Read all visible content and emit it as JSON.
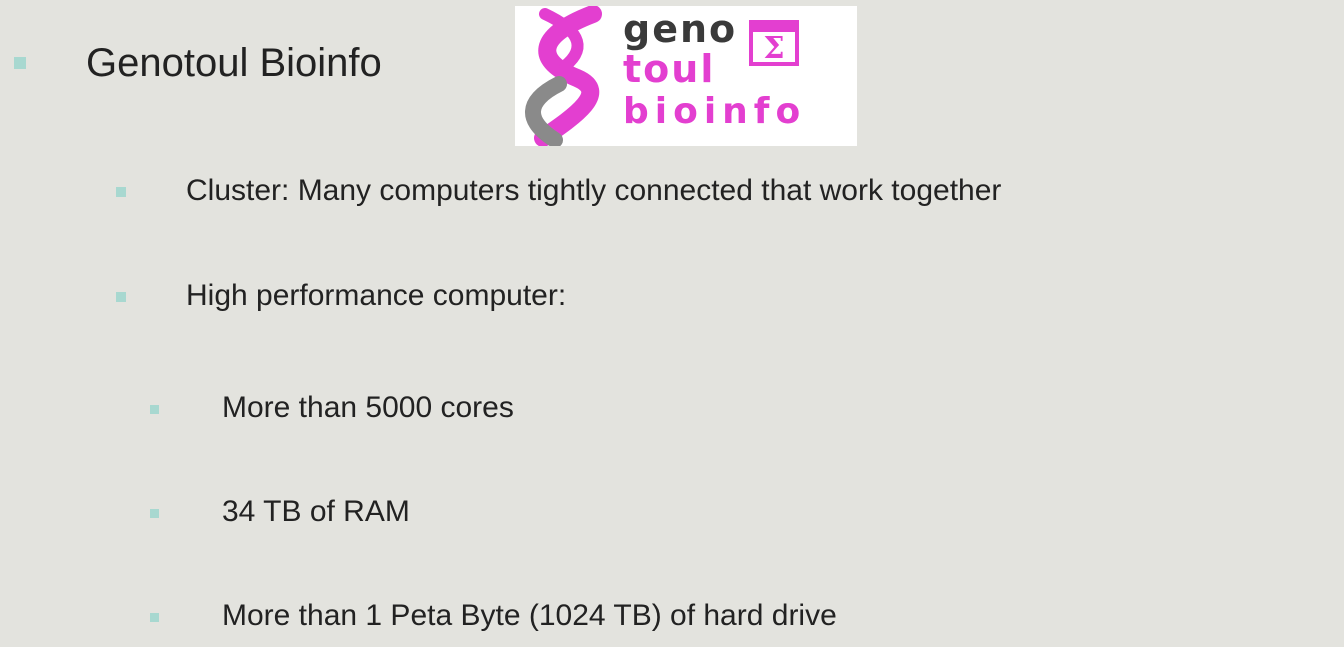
{
  "slide": {
    "heading": "Genotoul Bioinfo",
    "logo": {
      "word1": "geno",
      "word2": "toul",
      "word3": "bioinfo",
      "sigma": "Σ",
      "colors": {
        "magenta": "#e33fd0",
        "grey": "#3a3a3a"
      }
    },
    "items": [
      "Cluster: Many computers tightly connected that work together",
      "High performance computer:",
      "More than 5000 cores",
      "34 TB of RAM",
      "More than 1 Peta Byte (1024 TB) of hard drive"
    ],
    "colors": {
      "background": "#e3e3de",
      "bullet": "#a8d8d0",
      "text": "#222222"
    }
  }
}
